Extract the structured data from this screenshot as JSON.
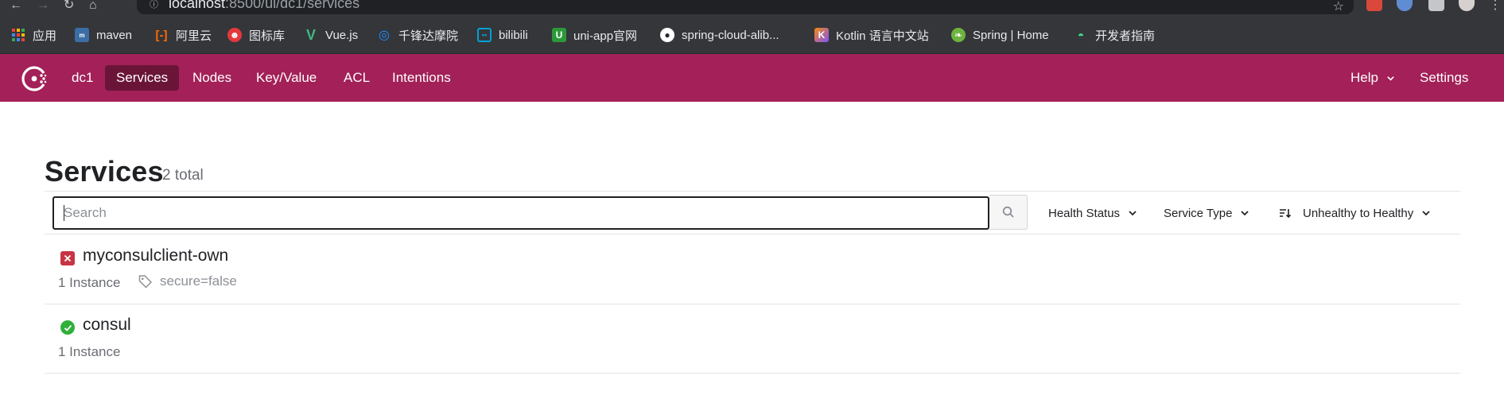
{
  "browser": {
    "url_host": "localhost",
    "url_rest": ":8500/ui/dc1/services",
    "bookmarks": [
      {
        "label": "应用",
        "icon": "apps-grid-icon",
        "color": "#4285f4"
      },
      {
        "label": "maven",
        "icon": "maven-icon",
        "color": "#3b6ea5"
      },
      {
        "label": "阿里云",
        "icon": "aliyun-icon",
        "color": "#ff6a00"
      },
      {
        "label": "图标库",
        "icon": "iconfont-icon",
        "color": "#e4393c"
      },
      {
        "label": "Vue.js",
        "icon": "vue-icon",
        "color": "#41b883"
      },
      {
        "label": "千锋达摩院",
        "icon": "qianfeng-icon",
        "color": "#1e90ff"
      },
      {
        "label": "bilibili",
        "icon": "bilibili-icon",
        "color": "#00a1d6"
      },
      {
        "label": "uni-app官网",
        "icon": "uniapp-icon",
        "color": "#2b9939"
      },
      {
        "label": "spring-cloud-alib...",
        "icon": "github-icon",
        "color": "#ffffff"
      },
      {
        "label": "Kotlin 语言中文站",
        "icon": "kotlin-icon",
        "color": "#7f52ff"
      },
      {
        "label": "Spring | Home",
        "icon": "spring-icon",
        "color": "#6db33f"
      },
      {
        "label": "开发者指南",
        "icon": "android-icon",
        "color": "#3ddc84"
      }
    ]
  },
  "nav": {
    "datacenter": "dc1",
    "items": [
      {
        "label": "Services",
        "active": true
      },
      {
        "label": "Nodes",
        "active": false
      },
      {
        "label": "Key/Value",
        "active": false
      },
      {
        "label": "ACL",
        "active": false
      },
      {
        "label": "Intentions",
        "active": false
      }
    ],
    "help": "Help",
    "settings": "Settings",
    "brand_color": "#a32058",
    "active_color": "#6a1538"
  },
  "page": {
    "title": "Services",
    "count": "2 total"
  },
  "toolbar": {
    "search_placeholder": "Search",
    "health_status": "Health Status",
    "service_type": "Service Type",
    "sort": "Unhealthy to Healthy"
  },
  "services": [
    {
      "name": "myconsulclient-own",
      "status": "critical",
      "status_color": "#c73445",
      "instances": "1 Instance",
      "tag": "secure=false"
    },
    {
      "name": "consul",
      "status": "passing",
      "status_color": "#2eb039",
      "instances": "1 Instance",
      "tag": ""
    }
  ]
}
